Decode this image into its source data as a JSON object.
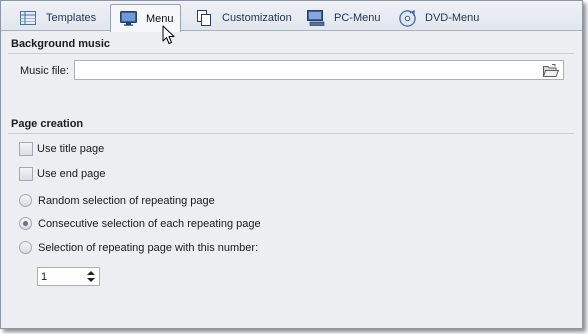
{
  "tabs": [
    {
      "label": "Templates",
      "icon": "templates-icon"
    },
    {
      "label": "Menu",
      "icon": "monitor-icon",
      "active": true
    },
    {
      "label": "Customization",
      "icon": "pages-icon"
    },
    {
      "label": "PC-Menu",
      "icon": "pc-icon"
    },
    {
      "label": "DVD-Menu",
      "icon": "dvd-icon"
    }
  ],
  "background_music": {
    "title": "Background music",
    "music_file_label": "Music file:",
    "music_file_value": ""
  },
  "page_creation": {
    "title": "Page creation",
    "use_title_page": "Use title page",
    "use_end_page": "Use end page",
    "random_selection": "Random selection of repeating page",
    "consecutive_selection": "Consecutive selection of each repeating page",
    "number_selection": "Selection of repeating page with this number:",
    "page_number": "1",
    "selected_option": "consecutive"
  },
  "colors": {
    "panel_background": "#eceef2",
    "accent": "#2a56b0"
  }
}
